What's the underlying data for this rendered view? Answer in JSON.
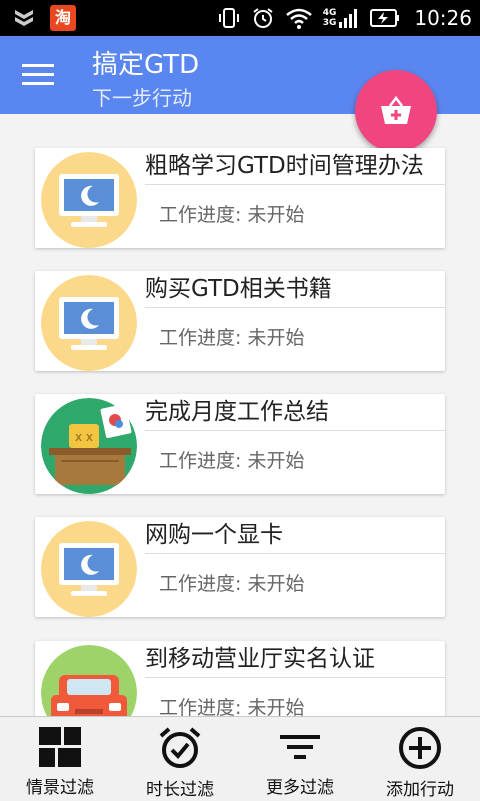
{
  "status_bar": {
    "left_icons": [
      "notification-shield-icon",
      "taobao-app-icon"
    ],
    "taobao_glyph": "淘",
    "network_top": "4G",
    "network_bottom": "3G",
    "time": "10:26"
  },
  "app_bar": {
    "title": "搞定GTD",
    "subtitle": "下一步行动",
    "menu_icon": "hamburger-menu-icon",
    "fab_icon": "basket-add-icon",
    "fab_color": "#f0457f",
    "accent": "#5a86f0"
  },
  "actions": [
    {
      "title": "粗略学习GTD时间管理办法",
      "progress_label": "工作进度: ",
      "progress_value": "未开始",
      "icon": "monitor-moon-icon"
    },
    {
      "title": "购买GTD相关书籍",
      "progress_label": "工作进度: ",
      "progress_value": "未开始",
      "icon": "monitor-moon-icon"
    },
    {
      "title": "完成月度工作总结",
      "progress_label": "工作进度: ",
      "progress_value": "未开始",
      "icon": "office-desk-icon"
    },
    {
      "title": "网购一个显卡",
      "progress_label": "工作进度: ",
      "progress_value": "未开始",
      "icon": "monitor-moon-icon"
    },
    {
      "title": "到移动营业厅实名认证",
      "progress_label": "工作进度: ",
      "progress_value": "未开始",
      "icon": "car-icon"
    }
  ],
  "bottom_nav": [
    {
      "label": "情景过滤",
      "icon": "grid-filter-icon"
    },
    {
      "label": "时长过滤",
      "icon": "alarm-clock-icon"
    },
    {
      "label": "更多过滤",
      "icon": "filter-lines-icon"
    },
    {
      "label": "添加行动",
      "icon": "add-circle-icon"
    }
  ]
}
